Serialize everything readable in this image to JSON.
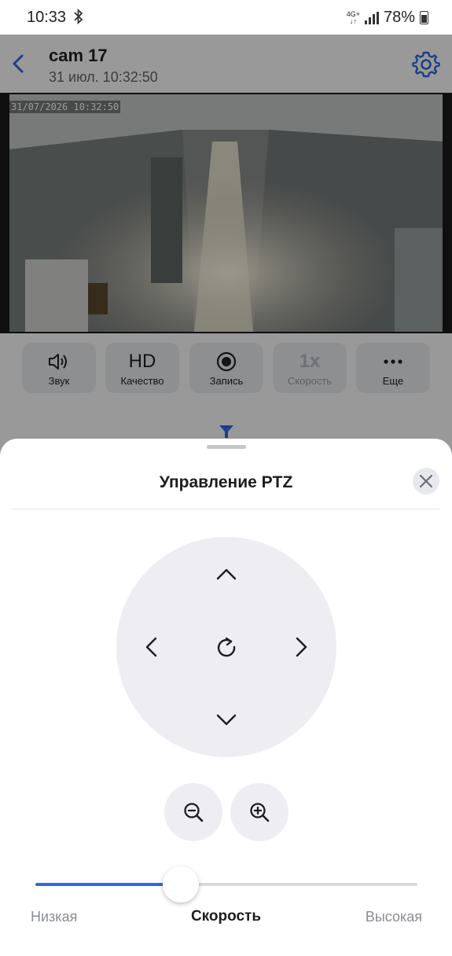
{
  "status_bar": {
    "time": "10:33",
    "network": "4G+",
    "battery_percent": "78%"
  },
  "header": {
    "title": "cam 17",
    "subtitle": "31 июл. 10:32:50"
  },
  "video": {
    "timestamp": "31/07/2026 10:32:50"
  },
  "controls": [
    {
      "label": "Звук",
      "icon": "speaker-icon"
    },
    {
      "label": "Качество",
      "icon_text": "HD"
    },
    {
      "label": "Запись",
      "icon": "record-icon"
    },
    {
      "label": "Скорость",
      "icon_text": "1x",
      "disabled": true
    },
    {
      "label": "Еще",
      "icon": "more-icon"
    }
  ],
  "ptz_sheet": {
    "title": "Управление PTZ",
    "speed": {
      "label": "Скорость",
      "low": "Низкая",
      "high": "Высокая",
      "value_fraction": 0.38
    }
  },
  "colors": {
    "accent": "#2f6be0",
    "surface": "#ededf2"
  }
}
